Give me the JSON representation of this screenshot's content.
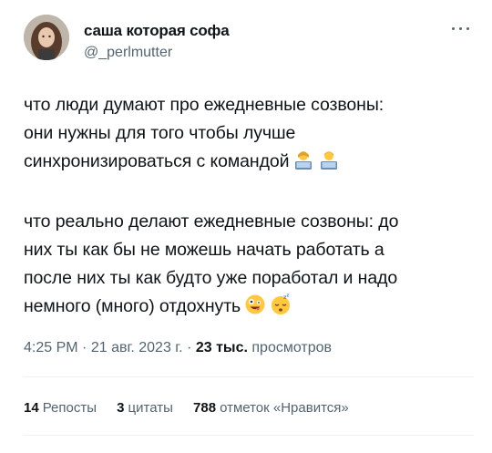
{
  "author": {
    "name": "саша которая софа",
    "handle": "@_perlmutter"
  },
  "tweet": {
    "paragraph1": [
      "что люди думают про ежедневные созвоны:",
      "они нужны для того чтобы лучше",
      "синхронизироваться с командой"
    ],
    "paragraph2": [
      "что реально делают ежедневные созвоны: до",
      "них ты как бы не можешь начать работать а",
      "после них ты как будто уже поработал и надо",
      "немного (много) отдохнуть"
    ],
    "emoji1": [
      "woman-technologist-emoji",
      "man-technologist-emoji"
    ],
    "emoji2": [
      "zany-face-emoji",
      "sleepy-face-emoji"
    ]
  },
  "meta": {
    "time": "4:25 PM",
    "date": "21 авг. 2023 г.",
    "separator": "·",
    "views_count": "23 тыс.",
    "views_label": "просмотров"
  },
  "stats": {
    "reposts_count": "14",
    "reposts_label": "Репосты",
    "quotes_count": "3",
    "quotes_label": "цитаты",
    "likes_count": "788",
    "likes_label": "отметок «Нравится»"
  },
  "colors": {
    "text": "#0f1419",
    "secondary": "#536471",
    "divider": "#eff3f4"
  }
}
